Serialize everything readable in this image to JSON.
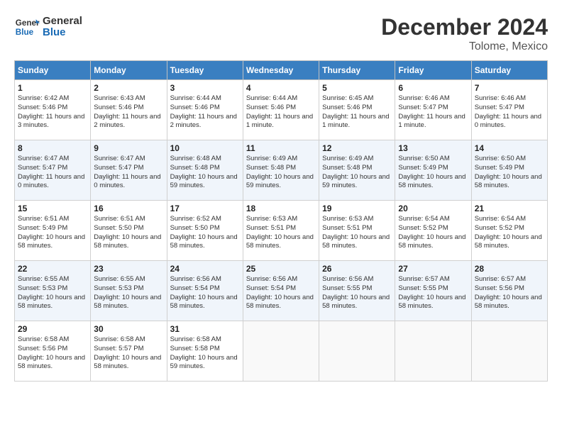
{
  "header": {
    "logo_line1": "General",
    "logo_line2": "Blue",
    "month_title": "December 2024",
    "location": "Tolome, Mexico"
  },
  "weekdays": [
    "Sunday",
    "Monday",
    "Tuesday",
    "Wednesday",
    "Thursday",
    "Friday",
    "Saturday"
  ],
  "weeks": [
    [
      {
        "day": "1",
        "sunrise": "6:42 AM",
        "sunset": "5:46 PM",
        "daylight": "11 hours and 3 minutes."
      },
      {
        "day": "2",
        "sunrise": "6:43 AM",
        "sunset": "5:46 PM",
        "daylight": "11 hours and 2 minutes."
      },
      {
        "day": "3",
        "sunrise": "6:44 AM",
        "sunset": "5:46 PM",
        "daylight": "11 hours and 2 minutes."
      },
      {
        "day": "4",
        "sunrise": "6:44 AM",
        "sunset": "5:46 PM",
        "daylight": "11 hours and 1 minute."
      },
      {
        "day": "5",
        "sunrise": "6:45 AM",
        "sunset": "5:46 PM",
        "daylight": "11 hours and 1 minute."
      },
      {
        "day": "6",
        "sunrise": "6:46 AM",
        "sunset": "5:47 PM",
        "daylight": "11 hours and 1 minute."
      },
      {
        "day": "7",
        "sunrise": "6:46 AM",
        "sunset": "5:47 PM",
        "daylight": "11 hours and 0 minutes."
      }
    ],
    [
      {
        "day": "8",
        "sunrise": "6:47 AM",
        "sunset": "5:47 PM",
        "daylight": "11 hours and 0 minutes."
      },
      {
        "day": "9",
        "sunrise": "6:47 AM",
        "sunset": "5:47 PM",
        "daylight": "11 hours and 0 minutes."
      },
      {
        "day": "10",
        "sunrise": "6:48 AM",
        "sunset": "5:48 PM",
        "daylight": "10 hours and 59 minutes."
      },
      {
        "day": "11",
        "sunrise": "6:49 AM",
        "sunset": "5:48 PM",
        "daylight": "10 hours and 59 minutes."
      },
      {
        "day": "12",
        "sunrise": "6:49 AM",
        "sunset": "5:48 PM",
        "daylight": "10 hours and 59 minutes."
      },
      {
        "day": "13",
        "sunrise": "6:50 AM",
        "sunset": "5:49 PM",
        "daylight": "10 hours and 58 minutes."
      },
      {
        "day": "14",
        "sunrise": "6:50 AM",
        "sunset": "5:49 PM",
        "daylight": "10 hours and 58 minutes."
      }
    ],
    [
      {
        "day": "15",
        "sunrise": "6:51 AM",
        "sunset": "5:49 PM",
        "daylight": "10 hours and 58 minutes."
      },
      {
        "day": "16",
        "sunrise": "6:51 AM",
        "sunset": "5:50 PM",
        "daylight": "10 hours and 58 minutes."
      },
      {
        "day": "17",
        "sunrise": "6:52 AM",
        "sunset": "5:50 PM",
        "daylight": "10 hours and 58 minutes."
      },
      {
        "day": "18",
        "sunrise": "6:53 AM",
        "sunset": "5:51 PM",
        "daylight": "10 hours and 58 minutes."
      },
      {
        "day": "19",
        "sunrise": "6:53 AM",
        "sunset": "5:51 PM",
        "daylight": "10 hours and 58 minutes."
      },
      {
        "day": "20",
        "sunrise": "6:54 AM",
        "sunset": "5:52 PM",
        "daylight": "10 hours and 58 minutes."
      },
      {
        "day": "21",
        "sunrise": "6:54 AM",
        "sunset": "5:52 PM",
        "daylight": "10 hours and 58 minutes."
      }
    ],
    [
      {
        "day": "22",
        "sunrise": "6:55 AM",
        "sunset": "5:53 PM",
        "daylight": "10 hours and 58 minutes."
      },
      {
        "day": "23",
        "sunrise": "6:55 AM",
        "sunset": "5:53 PM",
        "daylight": "10 hours and 58 minutes."
      },
      {
        "day": "24",
        "sunrise": "6:56 AM",
        "sunset": "5:54 PM",
        "daylight": "10 hours and 58 minutes."
      },
      {
        "day": "25",
        "sunrise": "6:56 AM",
        "sunset": "5:54 PM",
        "daylight": "10 hours and 58 minutes."
      },
      {
        "day": "26",
        "sunrise": "6:56 AM",
        "sunset": "5:55 PM",
        "daylight": "10 hours and 58 minutes."
      },
      {
        "day": "27",
        "sunrise": "6:57 AM",
        "sunset": "5:55 PM",
        "daylight": "10 hours and 58 minutes."
      },
      {
        "day": "28",
        "sunrise": "6:57 AM",
        "sunset": "5:56 PM",
        "daylight": "10 hours and 58 minutes."
      }
    ],
    [
      {
        "day": "29",
        "sunrise": "6:58 AM",
        "sunset": "5:56 PM",
        "daylight": "10 hours and 58 minutes."
      },
      {
        "day": "30",
        "sunrise": "6:58 AM",
        "sunset": "5:57 PM",
        "daylight": "10 hours and 58 minutes."
      },
      {
        "day": "31",
        "sunrise": "6:58 AM",
        "sunset": "5:58 PM",
        "daylight": "10 hours and 59 minutes."
      },
      null,
      null,
      null,
      null
    ]
  ]
}
